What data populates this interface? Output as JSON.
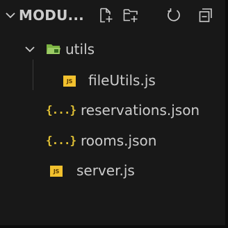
{
  "header": {
    "title": "MODU...",
    "actions": [
      {
        "name": "new-file",
        "label": "New File..."
      },
      {
        "name": "new-folder",
        "label": "New Folder..."
      },
      {
        "name": "refresh-explorer",
        "label": "Refresh Explorer"
      },
      {
        "name": "collapse-folders",
        "label": "Collapse Folders in Explorer"
      }
    ]
  },
  "tree": {
    "folder_utils": {
      "label": "utils",
      "icon": "folder-open-icon",
      "expanded": true
    },
    "file_fileutils": {
      "label": "fileUtils.js",
      "icon": "js-icon",
      "icon_text": "JS"
    },
    "file_reservations": {
      "label": "reservations.json",
      "icon": "json-icon",
      "icon_text": "{...}"
    },
    "file_rooms": {
      "label": "rooms.json",
      "icon": "json-icon",
      "icon_text": "{...}"
    },
    "file_server": {
      "label": "server.js",
      "icon": "js-icon",
      "icon_text": "JS"
    }
  },
  "colors": {
    "background": "#181818",
    "text": "#cccccc",
    "js_icon": "#f2c12e",
    "json_icon": "#e2c235",
    "folder_icon": "#8bc34a"
  }
}
